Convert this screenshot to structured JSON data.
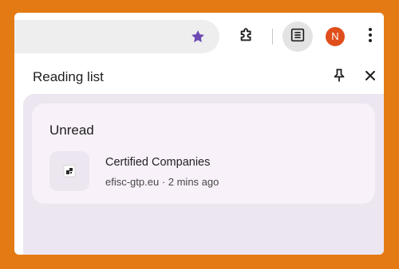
{
  "toolbar": {
    "bookmark_icon": "star-icon",
    "bookmark_color": "#6E4BB3",
    "extensions_icon": "puzzle-icon",
    "reading_list_icon": "reading-list-icon",
    "profile_initial": "N",
    "profile_color": "#E04E1C",
    "menu_icon": "kebab-menu-icon"
  },
  "panel": {
    "title": "Reading list",
    "pin_icon": "pin-icon",
    "close_icon": "close-icon"
  },
  "reading_list": {
    "section_title": "Unread",
    "items": [
      {
        "title": "Certified Companies",
        "domain": "efisc-gtp.eu",
        "separator": "·",
        "time": "2 mins ago",
        "meta": "efisc-gtp.eu · 2 mins ago"
      }
    ]
  },
  "colors": {
    "background": "#E47A13",
    "panel_bg": "#ECE6F0",
    "card_bg": "#F8F1F9"
  }
}
